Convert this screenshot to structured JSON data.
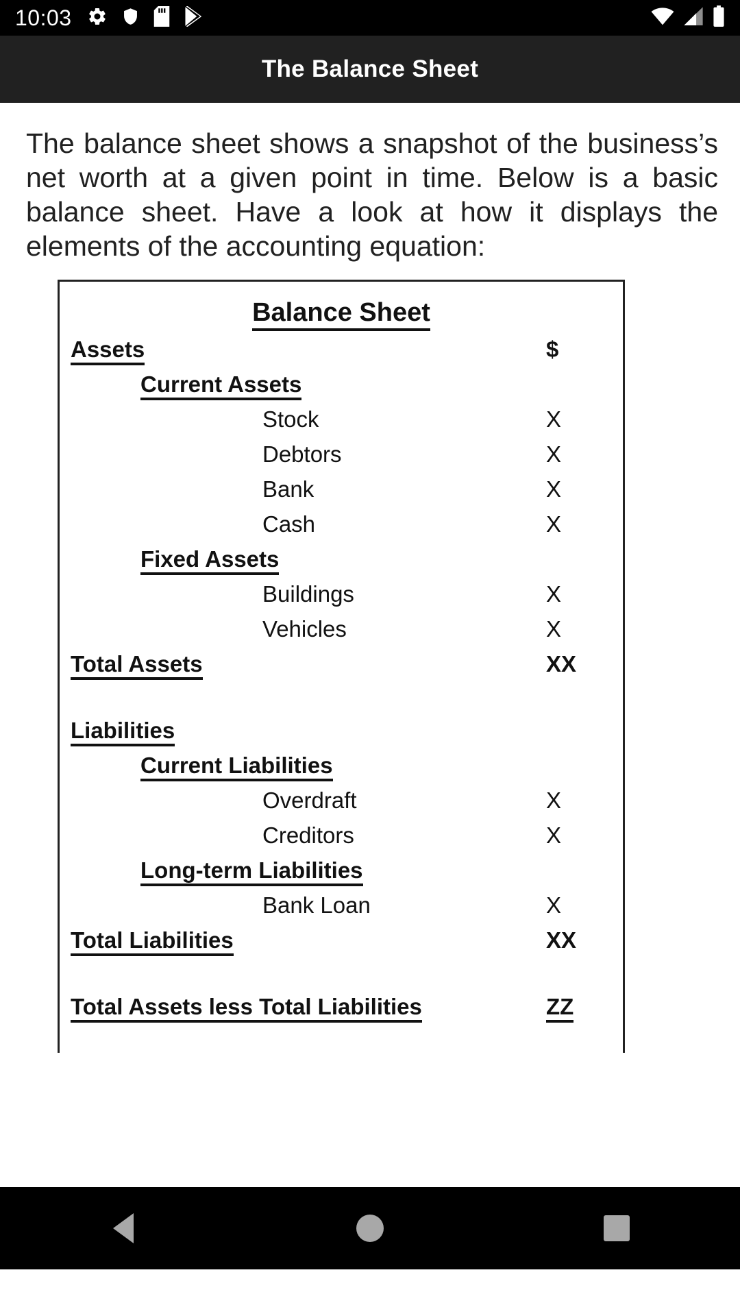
{
  "status_bar": {
    "clock": "10:03",
    "left_icons": [
      "gear-icon",
      "shield-icon",
      "sd-card-icon",
      "play-store-icon"
    ],
    "right_icons": [
      "wifi-icon",
      "cellular-signal-icon",
      "battery-icon"
    ]
  },
  "app_bar": {
    "title": "The Balance Sheet"
  },
  "main": {
    "intro_paragraph": "The balance sheet shows a snapshot of the business’s net worth at a given point in time. Below is a basic balance sheet. Have a look at how it displays the elements of the accounting equation:"
  },
  "balance_sheet": {
    "title": "Balance Sheet",
    "rows": [
      {
        "label": "Assets",
        "value": "$",
        "level": "section",
        "underline": true,
        "spacer_after": false
      },
      {
        "label": "Current Assets",
        "value": "",
        "level": "sub",
        "underline": true,
        "spacer_after": false
      },
      {
        "label": "Stock",
        "value": "X",
        "level": "item",
        "underline": false,
        "spacer_after": false
      },
      {
        "label": "Debtors",
        "value": "X",
        "level": "item",
        "underline": false,
        "spacer_after": false
      },
      {
        "label": "Bank",
        "value": "X",
        "level": "item",
        "underline": false,
        "spacer_after": false
      },
      {
        "label": "Cash",
        "value": "X",
        "level": "item",
        "underline": false,
        "spacer_after": false
      },
      {
        "label": "Fixed Assets",
        "value": "",
        "level": "sub",
        "underline": true,
        "spacer_after": false
      },
      {
        "label": "Buildings",
        "value": "X",
        "level": "item",
        "underline": false,
        "spacer_after": false
      },
      {
        "label": "Vehicles",
        "value": "X",
        "level": "item",
        "underline": false,
        "spacer_after": false
      },
      {
        "label": "Total Assets",
        "value": "XX",
        "level": "total",
        "underline": true,
        "spacer_after": true
      },
      {
        "label": "Liabilities",
        "value": "",
        "level": "section",
        "underline": true,
        "spacer_after": false
      },
      {
        "label": "Current Liabilities",
        "value": "",
        "level": "sub",
        "underline": true,
        "spacer_after": false
      },
      {
        "label": "Overdraft",
        "value": "X",
        "level": "item",
        "underline": false,
        "spacer_after": false
      },
      {
        "label": "Creditors",
        "value": "X",
        "level": "item",
        "underline": false,
        "spacer_after": false
      },
      {
        "label": "Long-term Liabilities",
        "value": "",
        "level": "sub",
        "underline": true,
        "spacer_after": false
      },
      {
        "label": "Bank Loan",
        "value": "X",
        "level": "item",
        "underline": false,
        "spacer_after": false
      },
      {
        "label": "Total Liabilities",
        "value": "XX",
        "level": "total",
        "underline": true,
        "spacer_after": true
      },
      {
        "label": "Total Assets less Total Liabilities",
        "value": "ZZ",
        "level": "total",
        "underline": true,
        "value_underline": true,
        "spacer_after": false
      }
    ]
  },
  "nav_bar": {
    "back_label": "back-button",
    "home_label": "home-button",
    "recents_label": "recents-button"
  }
}
